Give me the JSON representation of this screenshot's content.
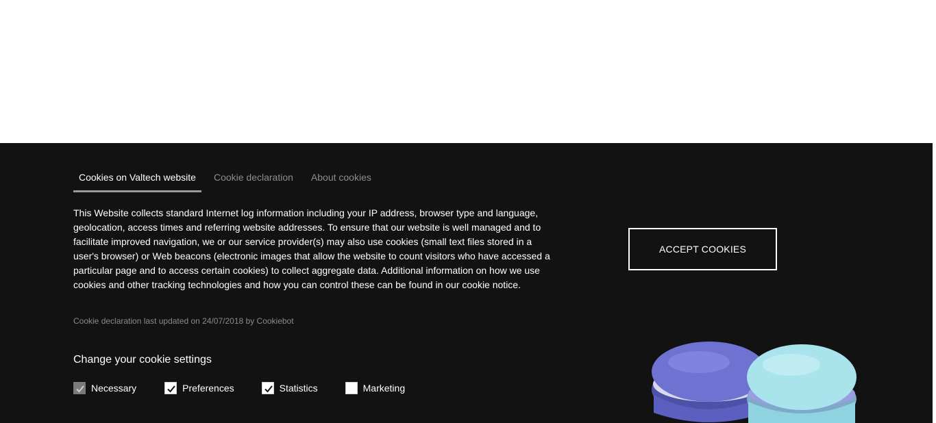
{
  "tabs": [
    {
      "label": "Cookies on Valtech website",
      "active": true
    },
    {
      "label": "Cookie declaration",
      "active": false
    },
    {
      "label": "About cookies",
      "active": false
    }
  ],
  "body_text": "This Website collects standard Internet log information including your IP address, browser type and language, geolocation, access times and referring website addresses. To ensure that our website is well managed and to facilitate improved navigation, we or our service provider(s) may also use cookies (small text files stored in a user's browser) or Web beacons (electronic images that allow the website to count visitors who have accessed a particular page and to access certain cookies) to collect aggregate data. Additional information on how we use cookies and other tracking technologies and how you can control these can be found in our cookie notice.",
  "updated_note": "Cookie declaration last updated on 24/07/2018 by Cookiebot",
  "settings": {
    "title": "Change your cookie settings",
    "options": [
      {
        "label": "Necessary",
        "checked": true,
        "disabled": true
      },
      {
        "label": "Preferences",
        "checked": true,
        "disabled": false
      },
      {
        "label": "Statistics",
        "checked": true,
        "disabled": false
      },
      {
        "label": "Marketing",
        "checked": false,
        "disabled": false
      }
    ]
  },
  "accept_label": "ACCEPT COOKIES",
  "colors": {
    "banner_bg": "#121212",
    "text": "#ffffff",
    "muted_text": "#8e8e8e",
    "macaron_purple": "#6e73d2",
    "macaron_blue": "#a9e3ec"
  },
  "icons": {
    "checkmark": "check-icon",
    "decor": "macarons-image"
  }
}
